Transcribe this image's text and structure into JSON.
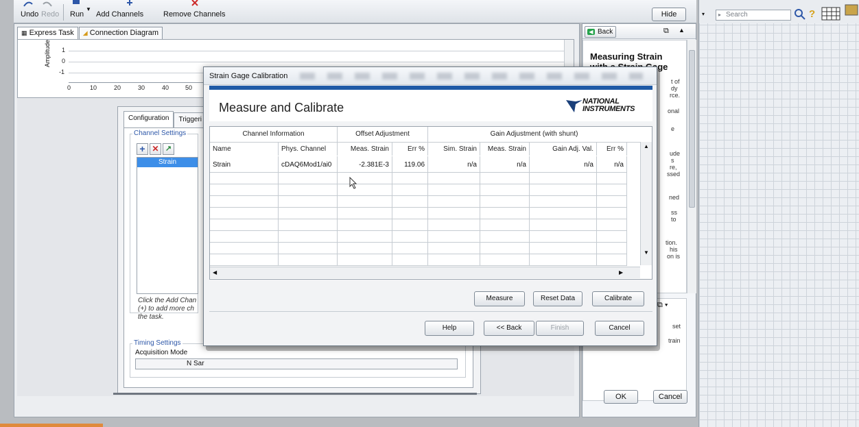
{
  "toolbar": {
    "undo": "Undo",
    "redo": "Redo",
    "run": "Run",
    "add_channels": "Add Channels",
    "remove_channels": "Remove Channels",
    "hide_help": "Hide Help"
  },
  "main": {
    "tabs": [
      {
        "label": "Express Task"
      },
      {
        "label": "Connection Diagram"
      }
    ],
    "graph": {
      "y_label": "Amplitude",
      "y_ticks": [
        "1",
        "0",
        "-1"
      ],
      "x_ticks": [
        "0",
        "10",
        "20",
        "30",
        "40",
        "50"
      ]
    },
    "config": {
      "tabs": [
        "Configuration",
        "Triggeri"
      ],
      "channel_settings": "Channel Settings",
      "channels": [
        "Strain"
      ],
      "hint": [
        "Click the Add Chan",
        "(+) to add more ch",
        "the task."
      ],
      "timing_settings": "Timing Settings",
      "acquisition_mode": "Acquisition Mode",
      "acq_value": "N Sar"
    },
    "ok": "OK",
    "cancel": "Cancel"
  },
  "help": {
    "back": "Back",
    "title": [
      "Measuring Strain",
      "with a Strain Gage"
    ],
    "fragments": [
      "t of",
      "dy",
      "rce.",
      "onal",
      "e",
      "ude",
      "s",
      "re,",
      "ssed",
      "ned",
      "ss",
      "to",
      "tion.",
      "his",
      "on is"
    ],
    "lower": [
      "set",
      "train"
    ]
  },
  "search": {
    "placeholder": "Search"
  },
  "dialog": {
    "title": "Strain Gage Calibration",
    "heading": "Measure and Calibrate",
    "logo": [
      "NATIONAL",
      "INSTRUMENTS"
    ],
    "groups": [
      "Channel Information",
      "Offset Adjustment",
      "Gain Adjustment (with shunt)"
    ],
    "columns": [
      "Name",
      "Phys. Channel",
      "Meas. Strain",
      "Err %",
      "Sim. Strain",
      "Meas. Strain",
      "Gain Adj. Val.",
      "Err %"
    ],
    "rows": [
      [
        "Strain",
        "cDAQ6Mod1/ai0",
        "-2.381E-3",
        "119.06",
        "n/a",
        "n/a",
        "n/a",
        "n/a"
      ]
    ],
    "buttons": {
      "measure": "Measure",
      "reset": "Reset Data",
      "calibrate": "Calibrate",
      "help": "Help",
      "back": "<< Back",
      "finish": "Finish",
      "cancel": "Cancel"
    }
  },
  "colors": {
    "accent": "#1f5aa6",
    "selection": "#3d8ee8"
  }
}
